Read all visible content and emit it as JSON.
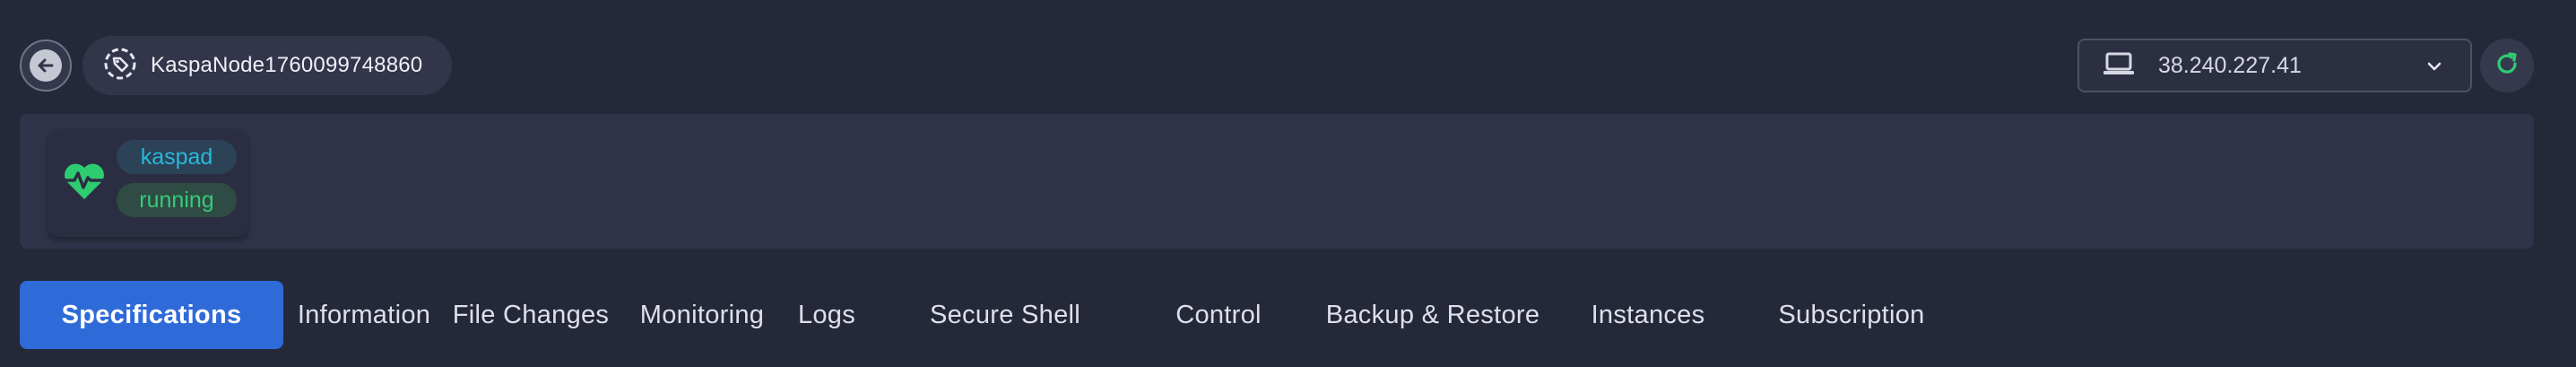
{
  "header": {
    "node_name": "KaspaNode1760099748860",
    "ip_address": "38.240.227.41"
  },
  "service": {
    "name": "kaspad",
    "status": "running"
  },
  "tabs": [
    {
      "label": "Specifications",
      "active": true
    },
    {
      "label": "Information"
    },
    {
      "label": "File Changes"
    },
    {
      "label": "Monitoring"
    },
    {
      "label": "Logs"
    },
    {
      "label": "Secure Shell"
    },
    {
      "label": "Control"
    },
    {
      "label": "Backup & Restore"
    },
    {
      "label": "Instances"
    },
    {
      "label": "Subscription"
    }
  ],
  "colors": {
    "background": "#252839",
    "panel": "#30334a",
    "accent": "#2f6bd8",
    "success": "#39c97c",
    "info": "#28b9d9"
  },
  "icons": [
    "arrow-left-icon",
    "tag-icon",
    "laptop-icon",
    "chevron-down-icon",
    "refresh-icon",
    "heart-pulse-icon"
  ]
}
